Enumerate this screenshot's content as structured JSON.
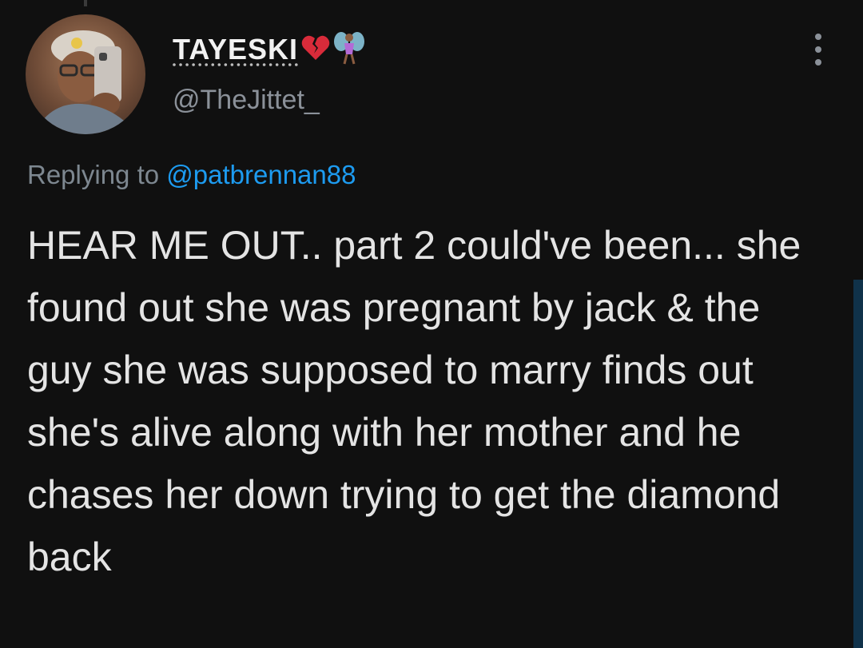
{
  "tweet": {
    "display_name": "TAYESKI",
    "name_emojis": [
      "broken-heart-icon",
      "fairy-icon"
    ],
    "handle": "@TheJittet_",
    "replying_prefix": "Replying to",
    "replying_to": "@patbrennan88",
    "text": "HEAR ME OUT.. part 2 could've been... she found out she was pregnant by jack & the guy she was supposed to marry finds out she's alive along with her mother and he chases her down trying to get the diamond back"
  },
  "colors": {
    "background": "#101010",
    "mention": "#1d9bf0",
    "secondary_text": "#8b9199",
    "primary_text": "#e4e4e4"
  }
}
